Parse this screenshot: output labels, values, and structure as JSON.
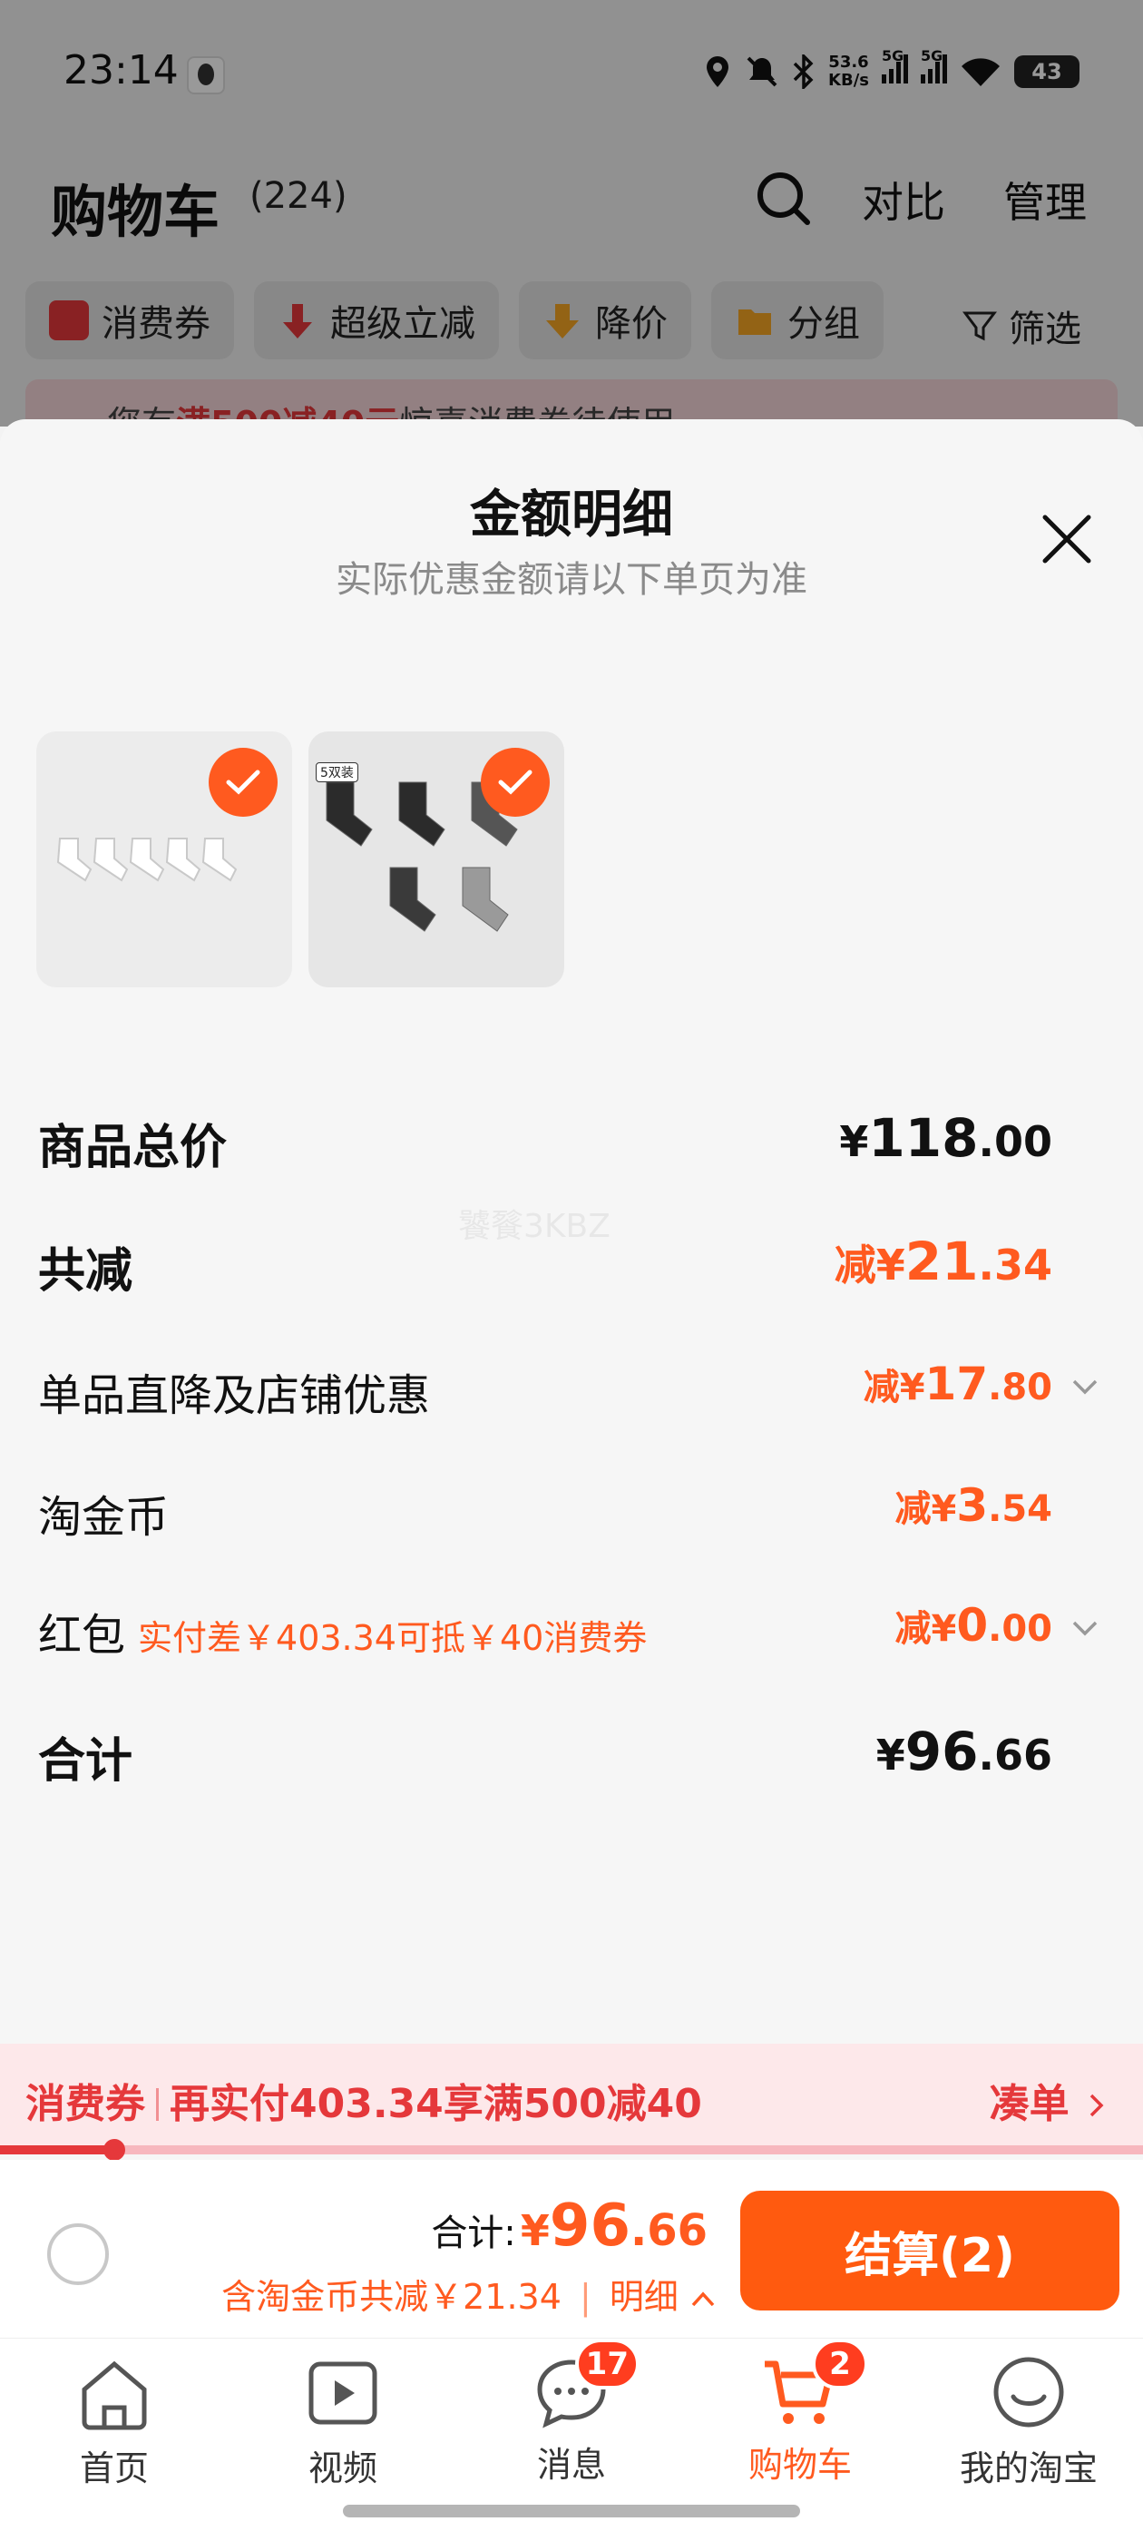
{
  "status_bar": {
    "time": "23:14",
    "net_speed_value": "53.6",
    "net_speed_unit": "KB/s",
    "sim1_label": "5G",
    "sim2_label": "5G",
    "battery": "43"
  },
  "header": {
    "title": "购物车",
    "count": "(224)",
    "compare": "对比",
    "manage": "管理"
  },
  "filters": [
    {
      "label": "消费券",
      "icon": "coupon-icon",
      "color": "#e5383b"
    },
    {
      "label": "超级立减",
      "icon": "arrow-down-icon",
      "color": "#e5383b"
    },
    {
      "label": "降价",
      "icon": "price-drop-icon",
      "color": "#f5a623"
    },
    {
      "label": "分组",
      "icon": "folder-icon",
      "color": "#f5a623"
    }
  ],
  "filter_plain": "筛选",
  "promo_strip": {
    "pre": "您有",
    "highlight": "满500减40元",
    "post": "惊喜消费券待使用"
  },
  "sheet": {
    "title": "金额明细",
    "subtitle": "实际优惠金额请以下单页为准",
    "thumb_tag": "5双装"
  },
  "rows": {
    "subtotal": {
      "label": "商品总价",
      "currency": "¥",
      "int": "118",
      "dec": ".00"
    },
    "total_discount": {
      "label": "共减",
      "prefix": "减¥",
      "int": "21",
      "dec": ".34"
    },
    "item_discount": {
      "label": "单品直降及店铺优惠",
      "prefix": "减¥",
      "int": "17",
      "dec": ".80"
    },
    "taojinbi": {
      "label": "淘金币",
      "prefix": "减¥",
      "int": "3",
      "dec": ".54"
    },
    "red_packet": {
      "label": "红包",
      "hint": "实付差￥403.34可抵￥40消费券",
      "prefix": "减¥",
      "int": "0",
      "dec": ".00"
    },
    "total": {
      "label": "合计",
      "currency": "¥",
      "int": "96",
      "dec": ".66"
    }
  },
  "watermark": "饕餮3KBZ",
  "coupon_bar": {
    "tag": "消费券",
    "text": "再实付403.34享满500减40",
    "link": "凑单",
    "progress": 0.1
  },
  "checkout": {
    "total_label": "合计:",
    "currency": "¥",
    "int": "96",
    "dec": ".66",
    "saved": "含淘金币共减￥21.34",
    "detail": "明细",
    "button": "结算(2)"
  },
  "tabbar": [
    {
      "label": "首页",
      "icon": "home-icon"
    },
    {
      "label": "视频",
      "icon": "video-icon"
    },
    {
      "label": "消息",
      "icon": "message-icon",
      "badge": "17"
    },
    {
      "label": "购物车",
      "icon": "cart-icon",
      "badge": "2",
      "active": true
    },
    {
      "label": "我的淘宝",
      "icon": "smile-icon"
    }
  ],
  "colors": {
    "accent": "#ff5a1f",
    "coupon_red": "#e5383b"
  }
}
